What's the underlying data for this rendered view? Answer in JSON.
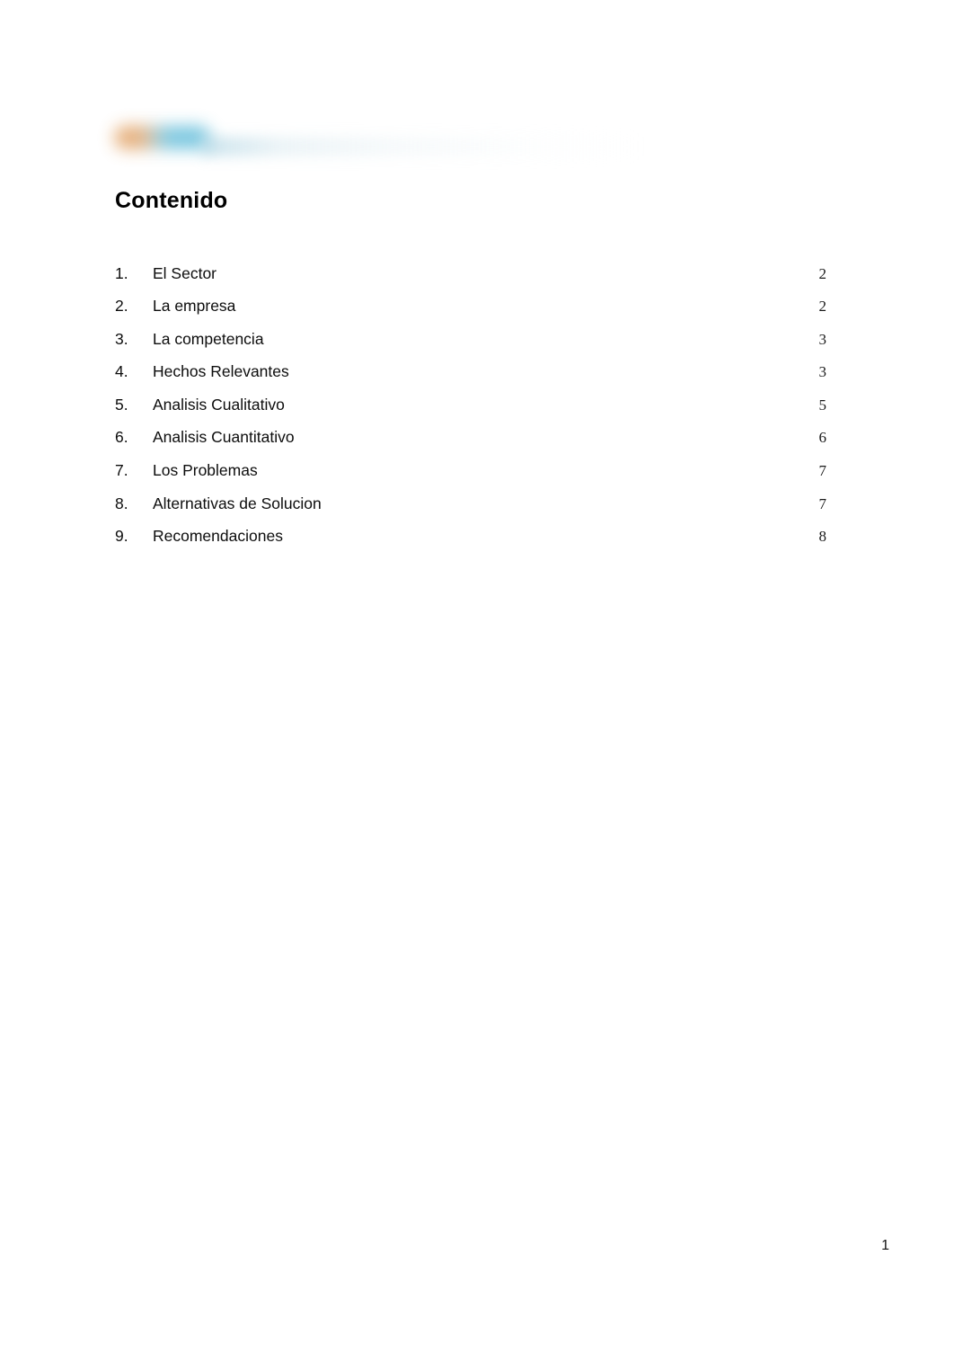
{
  "document": {
    "title": "Contenido",
    "footer_page_number": "1"
  },
  "header": {
    "logo": "redacted-company-logo",
    "logo_colors": {
      "accent_orange": "#e5a96f",
      "accent_teal": "#74c4de",
      "band_tint": "#cde2ea"
    }
  },
  "toc": {
    "entries": [
      {
        "number": "1.",
        "label": "El Sector",
        "page": "2"
      },
      {
        "number": "2.",
        "label": "La empresa",
        "page": "2"
      },
      {
        "number": "3.",
        "label": "La competencia",
        "page": "3"
      },
      {
        "number": "4.",
        "label": "Hechos Relevantes",
        "page": "3"
      },
      {
        "number": "5.",
        "label": "Analisis Cualitativo",
        "page": "5"
      },
      {
        "number": "6.",
        "label": "Analisis Cuantitativo",
        "page": "6"
      },
      {
        "number": "7.",
        "label": "Los Problemas",
        "page": "7"
      },
      {
        "number": "8.",
        "label": "Alternativas de Solucion",
        "page": "7"
      },
      {
        "number": "9.",
        "label": "Recomendaciones",
        "page": "8"
      }
    ]
  }
}
